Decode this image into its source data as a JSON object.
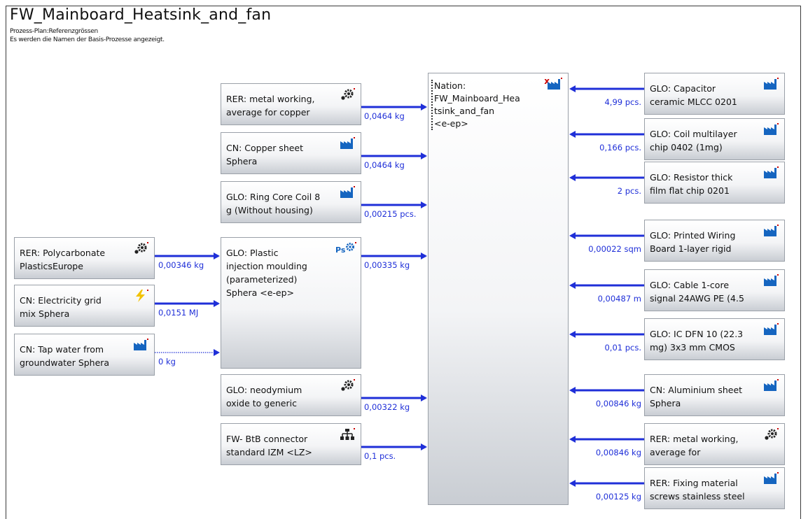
{
  "header": {
    "title": "FW_Mainboard_Heatsink_and_fan",
    "plan": "Prozess-Plan:Referenzgrössen",
    "note": "Es werden die Namen der Basis-Prozesse angezeigt."
  },
  "nation": {
    "label": "Nation:\nFW_Mainboard_Hea\ntsink_and_fan\n<e-ep>",
    "icon": "factory-icon"
  },
  "far_left": [
    {
      "label": "RER: Polycarbonate\nPlasticsEurope",
      "amount": "0,00346 kg",
      "icon": "gear-icon"
    },
    {
      "label": "CN: Electricity grid\nmix Sphera",
      "amount": "0,0151 MJ",
      "icon": "lightning-icon"
    },
    {
      "label": "CN: Tap water from\ngroundwater Sphera",
      "amount": "0 kg",
      "icon": "factory-icon"
    }
  ],
  "left": [
    {
      "label": "RER: metal working,\naverage for copper",
      "amount": "0,0464 kg",
      "icon": "gear-icon"
    },
    {
      "label": "CN: Copper sheet\nSphera",
      "amount": "0,0464 kg",
      "icon": "factory-icon"
    },
    {
      "label": "GLO: Ring Core Coil 8\ng (Without housing)",
      "amount": "0,00215 pcs.",
      "icon": "factory-icon"
    },
    {
      "label": "GLO: Plastic\ninjection moulding\n(parameterized)\nSphera <e-ep>",
      "amount": "0,00335 kg",
      "icon": "ps-gear-icon"
    },
    {
      "label": "GLO: neodymium\noxide to generic",
      "amount": "0,00322 kg",
      "icon": "gear-icon"
    },
    {
      "label": "FW- BtB connector\nstandard IZM <LZ>",
      "amount": "0,1 pcs.",
      "icon": "hierarchy-icon"
    }
  ],
  "right": [
    {
      "label": "GLO: Capacitor\nceramic MLCC 0201",
      "amount": "4,99 pcs.",
      "icon": "factory-icon"
    },
    {
      "label": "GLO: Coil multilayer\nchip 0402 (1mg)",
      "amount": "0,166 pcs.",
      "icon": "factory-icon"
    },
    {
      "label": "GLO: Resistor thick\nfilm flat chip 0201",
      "amount": "2 pcs.",
      "icon": "factory-icon"
    },
    {
      "label": "GLO: Printed Wiring\nBoard 1-layer rigid",
      "amount": "0,00022 sqm",
      "icon": "factory-icon"
    },
    {
      "label": "GLO: Cable 1-core\nsignal 24AWG PE (4.5",
      "amount": "0,00487 m",
      "icon": "factory-icon"
    },
    {
      "label": "GLO: IC DFN 10 (22.3\nmg) 3x3 mm CMOS",
      "amount": "0,01 pcs.",
      "icon": "factory-icon"
    },
    {
      "label": "CN: Aluminium sheet\nSphera",
      "amount": "0,00846 kg",
      "icon": "factory-icon"
    },
    {
      "label": "RER: metal working,\naverage for",
      "amount": "0,00846 kg",
      "icon": "gear-icon"
    },
    {
      "label": "RER: Fixing material\nscrews stainless steel",
      "amount": "0,00125 kg",
      "icon": "factory-icon"
    }
  ],
  "colors": {
    "flow": "#1f2fd8",
    "icon": "#1565c0",
    "gear": "#222222",
    "lightning": "#f2c200",
    "mark": "#cc0000"
  }
}
